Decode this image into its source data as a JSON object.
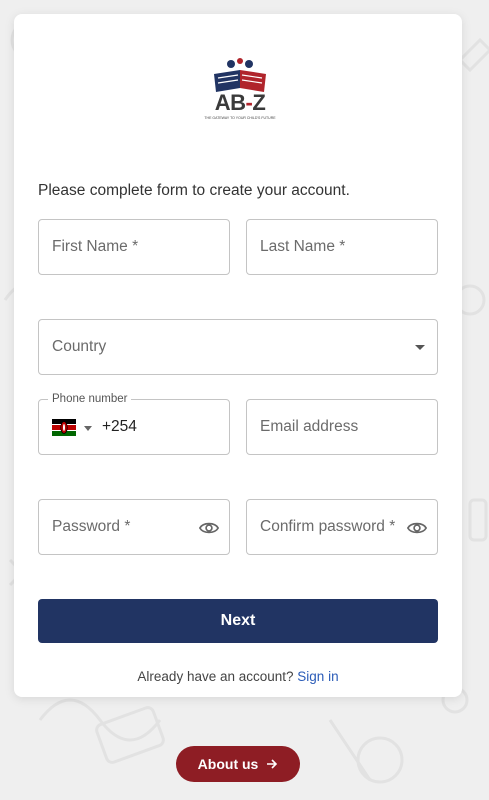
{
  "logo": {
    "brand": "AB",
    "brand_dash": "-",
    "brand_end": "Z",
    "tagline": "THE GATEWAY TO YOUR CHILD'S FUTURE"
  },
  "form": {
    "intro": "Please complete form to create your account.",
    "first_name_label": "First Name *",
    "last_name_label": "Last Name *",
    "country_label": "Country",
    "phone_label": "Phone number",
    "phone_country_code": "+254",
    "email_label": "Email address",
    "password_label": "Password *",
    "confirm_password_label": "Confirm password *",
    "next_label": "Next"
  },
  "signin": {
    "prompt": "Already have an account?",
    "link": "Sign in"
  },
  "about_button": {
    "label": "About us"
  },
  "colors": {
    "primary": "#213463",
    "accent": "#8e1d24",
    "link": "#2b5cb8"
  },
  "icons": {
    "flag": "kenya-flag-icon",
    "eye": "eye-icon",
    "arrow": "arrow-right-icon",
    "dropdown": "caret-down-icon"
  }
}
